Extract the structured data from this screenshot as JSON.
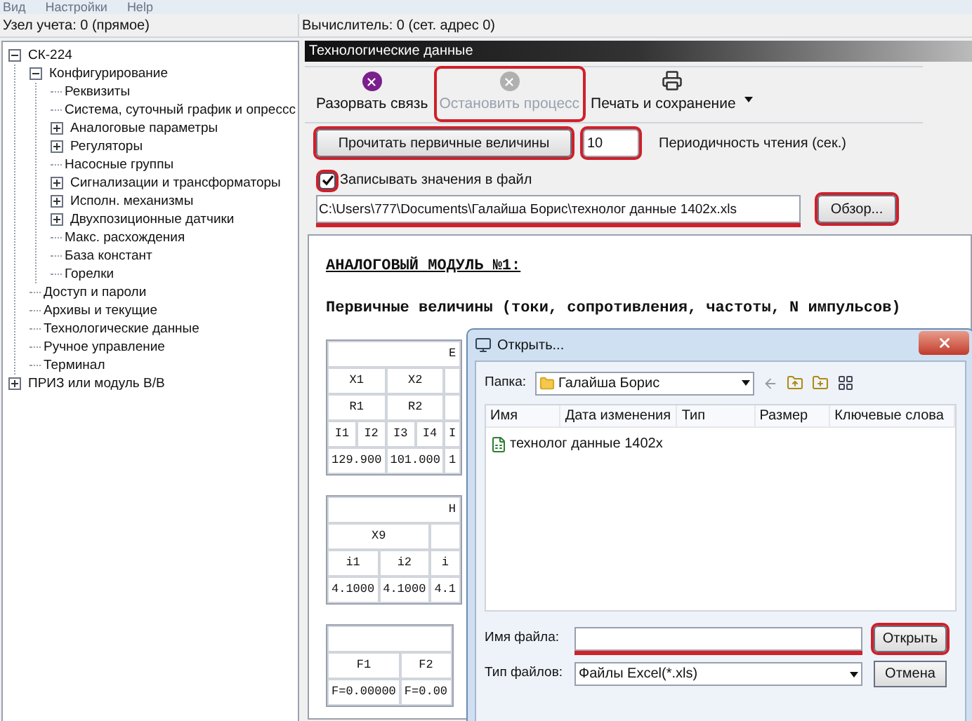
{
  "menu": [
    "Вид",
    "Настройки",
    "Help"
  ],
  "status": {
    "left": "Узел учета: 0 (прямое)",
    "right": "Вычислитель: 0 (сет. адрес 0)"
  },
  "tree": [
    {
      "label": "СК-224",
      "expanded": true,
      "children": [
        {
          "label": "Конфигурирование",
          "expanded": true,
          "children": [
            {
              "label": "Реквизиты"
            },
            {
              "label": "Система, суточный график и опрессс"
            },
            {
              "label": "Аналоговые параметры",
              "expanded": false
            },
            {
              "label": "Регуляторы",
              "expanded": false
            },
            {
              "label": "Насосные группы"
            },
            {
              "label": "Сигнализации и трансформаторы",
              "expanded": false
            },
            {
              "label": "Исполн. механизмы",
              "expanded": false
            },
            {
              "label": "Двухпозиционные датчики",
              "expanded": false
            },
            {
              "label": "Макс. расхождения"
            },
            {
              "label": "База констант"
            },
            {
              "label": "Горелки"
            }
          ]
        },
        {
          "label": "Доступ и пароли"
        },
        {
          "label": "Архивы и текущие"
        },
        {
          "label": "Технологические данные"
        },
        {
          "label": "Ручное управление"
        },
        {
          "label": "Терминал"
        }
      ]
    },
    {
      "label": "ПРИЗ или модуль В/В",
      "expanded": false
    }
  ],
  "panel_title": "Технологические данные",
  "toolbar": [
    {
      "kind": "disconnect",
      "label": "Разорвать связь",
      "disabled": false,
      "highlighted": false
    },
    {
      "kind": "stop",
      "label": "Остановить процесс",
      "disabled": true,
      "highlighted": true
    },
    {
      "kind": "print",
      "label": "Печать и сохранение",
      "disabled": false,
      "highlighted": false
    }
  ],
  "read_button": {
    "label": "Прочитать первичные величины",
    "highlighted": true
  },
  "period": {
    "value": "10",
    "label": "Периодичность чтения (сек.)",
    "highlighted": true
  },
  "save_to_file": {
    "label": "Записывать значения в файл",
    "checked": true,
    "highlighted": true
  },
  "file_path": {
    "value": "C:\\Users\\777\\Documents\\Галайша Борис\\технолог данные 1402x.xls",
    "highlighted": true
  },
  "browse_button": {
    "label": "Обзор...",
    "highlighted": true
  },
  "report": {
    "title": "АНАЛОГОВЫЙ МОДУЛЬ №1:",
    "subtitle": "Первичные величины (токи, сопротивления, частоты, N импульсов)",
    "tables": [
      {
        "rows": [
          [
            {
              "text": "Е",
              "colspan": 5
            }
          ],
          [
            {
              "text": "X1",
              "colspan": 2
            },
            {
              "text": "X2",
              "colspan": 2
            },
            {
              "text": ""
            }
          ],
          [
            {
              "text": "R1",
              "colspan": 2
            },
            {
              "text": "R2",
              "colspan": 2
            },
            {
              "text": ""
            }
          ],
          [
            {
              "text": "I1"
            },
            {
              "text": "I2"
            },
            {
              "text": "I3"
            },
            {
              "text": "I4"
            },
            {
              "text": "I"
            }
          ],
          [
            {
              "text": "129.900",
              "colspan": 2
            },
            {
              "text": "101.000",
              "colspan": 2
            },
            {
              "text": "1"
            }
          ]
        ]
      },
      {
        "rows": [
          [
            {
              "text": "Н",
              "colspan": 3
            }
          ],
          [
            {
              "text": "X9",
              "colspan": 2
            },
            {
              "text": ""
            }
          ],
          [
            {
              "text": "i1"
            },
            {
              "text": "i2"
            },
            {
              "text": "i"
            }
          ],
          [
            {
              "text": "4.1000"
            },
            {
              "text": "4.1000"
            },
            {
              "text": "4.1"
            }
          ]
        ]
      },
      {
        "rows": [
          [
            {
              "text": "",
              "colspan": 2
            }
          ],
          [
            {
              "text": "F1"
            },
            {
              "text": "F2"
            }
          ],
          [
            {
              "text": "F=0.00000"
            },
            {
              "text": "F=0.00"
            }
          ]
        ]
      }
    ]
  },
  "dialog": {
    "title": "Открыть...",
    "folder_label": "Папка:",
    "folder": "Галайша Борис",
    "columns": [
      "Имя",
      "Дата изменения",
      "Тип",
      "Размер",
      "Ключевые слова"
    ],
    "files": [
      {
        "name": "технолог данные 1402x",
        "selected": false
      }
    ],
    "filename_label": "Имя файла:",
    "filename": {
      "highlighted": true
    },
    "filetype_label": "Тип файлов:",
    "filetype": "Файлы Excel(*.xls)",
    "open_button": {
      "label": "Открыть",
      "highlighted": true
    },
    "cancel_button": {
      "label": "Отмена",
      "highlighted": false
    }
  }
}
